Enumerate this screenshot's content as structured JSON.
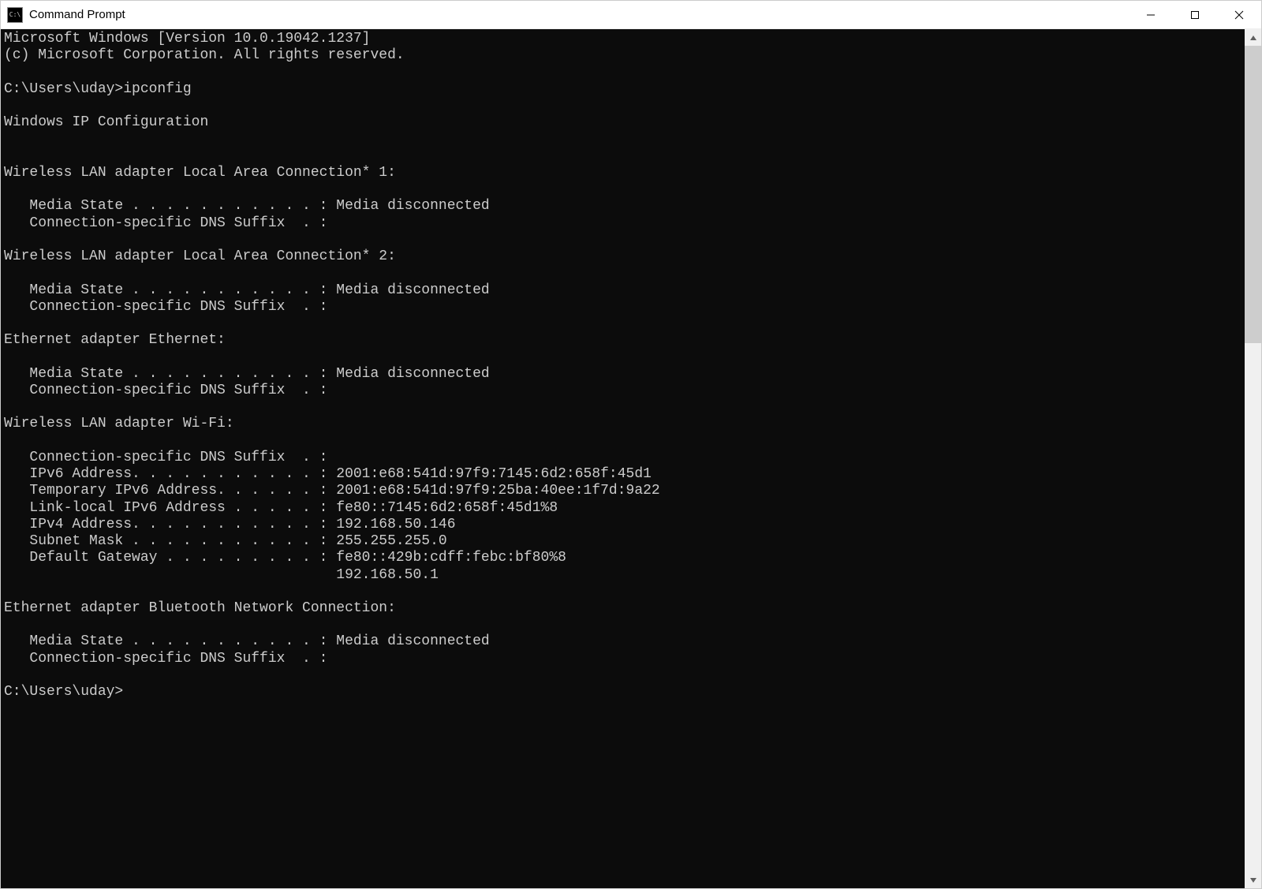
{
  "window": {
    "title": "Command Prompt"
  },
  "terminal": {
    "lines": [
      "Microsoft Windows [Version 10.0.19042.1237]",
      "(c) Microsoft Corporation. All rights reserved.",
      "",
      "C:\\Users\\uday>ipconfig",
      "",
      "Windows IP Configuration",
      "",
      "",
      "Wireless LAN adapter Local Area Connection* 1:",
      "",
      "   Media State . . . . . . . . . . . : Media disconnected",
      "   Connection-specific DNS Suffix  . :",
      "",
      "Wireless LAN adapter Local Area Connection* 2:",
      "",
      "   Media State . . . . . . . . . . . : Media disconnected",
      "   Connection-specific DNS Suffix  . :",
      "",
      "Ethernet adapter Ethernet:",
      "",
      "   Media State . . . . . . . . . . . : Media disconnected",
      "   Connection-specific DNS Suffix  . :",
      "",
      "Wireless LAN adapter Wi-Fi:",
      "",
      "   Connection-specific DNS Suffix  . :",
      "   IPv6 Address. . . . . . . . . . . : 2001:e68:541d:97f9:7145:6d2:658f:45d1",
      "   Temporary IPv6 Address. . . . . . : 2001:e68:541d:97f9:25ba:40ee:1f7d:9a22",
      "   Link-local IPv6 Address . . . . . : fe80::7145:6d2:658f:45d1%8",
      "   IPv4 Address. . . . . . . . . . . : 192.168.50.146",
      "   Subnet Mask . . . . . . . . . . . : 255.255.255.0",
      "   Default Gateway . . . . . . . . . : fe80::429b:cdff:febc:bf80%8",
      "                                       192.168.50.1",
      "",
      "Ethernet adapter Bluetooth Network Connection:",
      "",
      "   Media State . . . . . . . . . . . : Media disconnected",
      "   Connection-specific DNS Suffix  . :",
      "",
      "C:\\Users\\uday>"
    ]
  }
}
